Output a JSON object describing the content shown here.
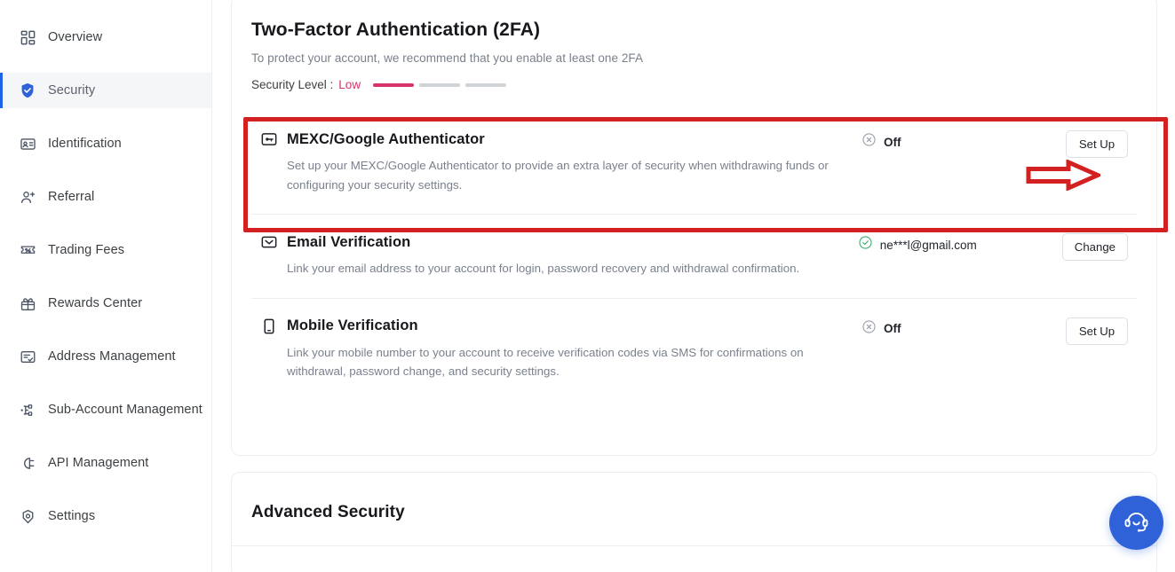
{
  "sidebar": {
    "items": [
      {
        "label": "Overview",
        "icon": "grid-icon",
        "active": false
      },
      {
        "label": "Security",
        "icon": "shield-check-icon",
        "active": true
      },
      {
        "label": "Identification",
        "icon": "id-card-icon",
        "active": false
      },
      {
        "label": "Referral",
        "icon": "user-plus-icon",
        "active": false
      },
      {
        "label": "Trading Fees",
        "icon": "ticket-percent-icon",
        "active": false
      },
      {
        "label": "Rewards Center",
        "icon": "gift-icon",
        "active": false
      },
      {
        "label": "Address Management",
        "icon": "address-list-icon",
        "active": false
      },
      {
        "label": "Sub-Account Management",
        "icon": "sub-account-icon",
        "active": false
      },
      {
        "label": "API Management",
        "icon": "plug-icon",
        "active": false
      },
      {
        "label": "Settings",
        "icon": "gear-eye-icon",
        "active": false
      }
    ]
  },
  "twofa": {
    "title": "Two-Factor Authentication (2FA)",
    "subtitle": "To protect your account, we recommend that you enable at least one 2FA",
    "security_level_label": "Security Level :",
    "security_level_value": "Low",
    "security_level_segments_total": 3,
    "security_level_segments_filled": 1,
    "rows": [
      {
        "icon": "key-box-icon",
        "title": "MEXC/Google Authenticator",
        "desc": "Set up your MEXC/Google Authenticator to provide an extra layer of security when withdrawing funds or configuring your security settings.",
        "status_icon": "circle-x-icon",
        "status": "Off",
        "action": "Set Up"
      },
      {
        "icon": "envelope-icon",
        "title": "Email Verification",
        "desc": "Link your email address to your account for login, password recovery and withdrawal confirmation.",
        "status_icon": "circle-check-icon",
        "status": "ne***l@gmail.com",
        "action": "Change"
      },
      {
        "icon": "mobile-icon",
        "title": "Mobile Verification",
        "desc": "Link your mobile number to your account to receive verification codes via SMS for confirmations on withdrawal, password change, and security settings.",
        "status_icon": "circle-x-icon",
        "status": "Off",
        "action": "Set Up"
      }
    ]
  },
  "advanced": {
    "title": "Advanced Security"
  },
  "annotations": {
    "highlight_color": "#d32020",
    "arrow_color": "#d32020",
    "arrow_target": "Set Up"
  },
  "chat": {
    "icon": "headset-support-icon",
    "accent": "#2f62d8"
  },
  "colors": {
    "accent_blue": "#1f63e8",
    "danger_pink": "#d6346a",
    "success_green": "#3fae6e",
    "muted_text": "#7a818c"
  }
}
